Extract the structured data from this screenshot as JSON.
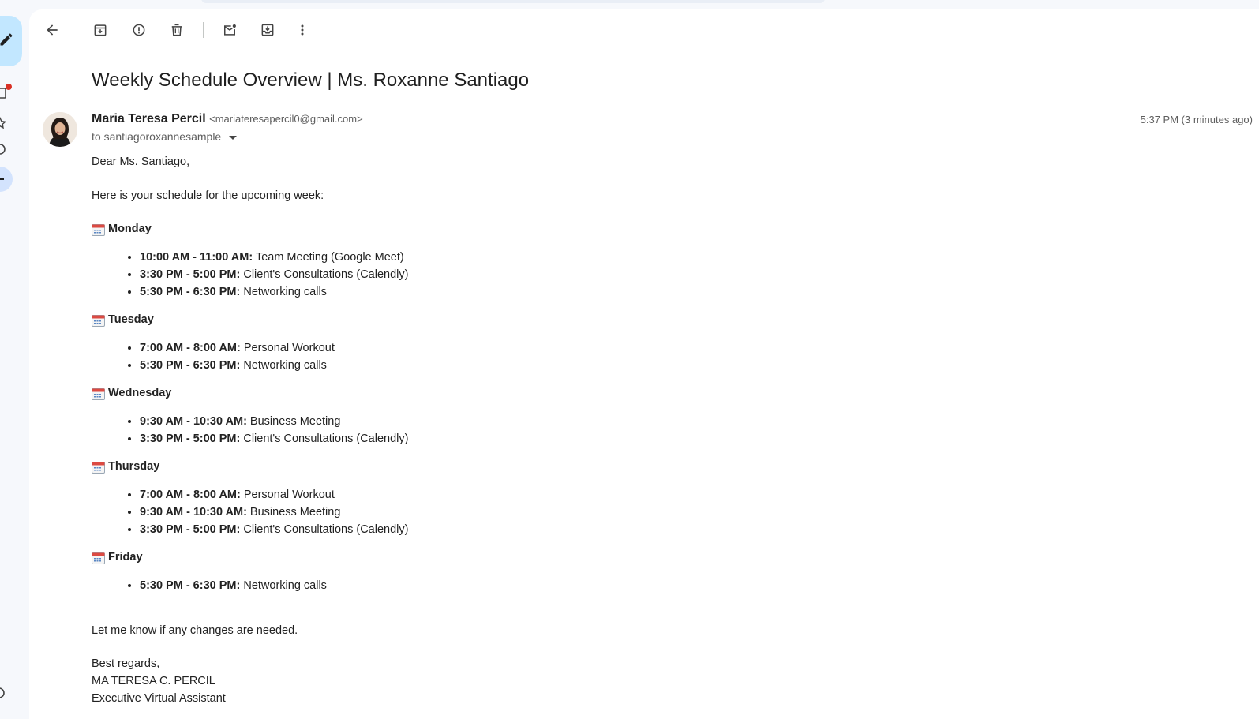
{
  "toolbar": {
    "back": "back",
    "archive": "archive",
    "report_spam": "report spam",
    "delete": "delete",
    "mark_unread": "mark as unread",
    "move_to": "move to",
    "more": "more"
  },
  "email": {
    "subject": "Weekly Schedule Overview | Ms. Roxanne Santiago",
    "sender_name": "Maria Teresa Percil",
    "sender_email": "<mariateresapercil0@gmail.com>",
    "to_line": "to santiagoroxannesample",
    "timestamp": "5:37 PM (3 minutes ago)",
    "greeting": "Dear Ms. Santiago,",
    "intro": "Here is your schedule for the upcoming week:",
    "days": [
      {
        "name": "Monday",
        "items": [
          {
            "time": "10:00 AM - 11:00 AM:",
            "task": " Team Meeting (Google Meet)"
          },
          {
            "time": "3:30 PM - 5:00 PM:",
            "task": " Client's Consultations (Calendly)"
          },
          {
            "time": "5:30 PM - 6:30 PM:",
            "task": " Networking calls"
          }
        ]
      },
      {
        "name": "Tuesday",
        "items": [
          {
            "time": "7:00 AM - 8:00 AM:",
            "task": " Personal Workout"
          },
          {
            "time": "5:30 PM - 6:30 PM:",
            "task": " Networking calls"
          }
        ]
      },
      {
        "name": "Wednesday",
        "items": [
          {
            "time": "9:30 AM - 10:30 AM:",
            "task": " Business Meeting"
          },
          {
            "time": "3:30 PM - 5:00 PM:",
            "task": " Client's Consultations (Calendly)"
          }
        ]
      },
      {
        "name": "Thursday",
        "items": [
          {
            "time": "7:00 AM - 8:00 AM:",
            "task": " Personal Workout"
          },
          {
            "time": "9:30 AM - 10:30 AM:",
            "task": " Business Meeting"
          },
          {
            "time": "3:30 PM - 5:00 PM:",
            "task": " Client's Consultations (Calendly)"
          }
        ]
      },
      {
        "name": "Friday",
        "items": [
          {
            "time": "5:30 PM - 6:30 PM:",
            "task": " Networking calls"
          }
        ]
      }
    ],
    "closing": "Let me know if any changes are needed.",
    "signoff": "Best regards,",
    "signature_name": "MA TERESA C. PERCIL",
    "signature_title": "Executive Virtual Assistant"
  },
  "colors": {
    "background": "#f6f8fc",
    "compose": "#c2e7ff",
    "active_nav": "#d3e3fd",
    "notification": "#d93025"
  }
}
